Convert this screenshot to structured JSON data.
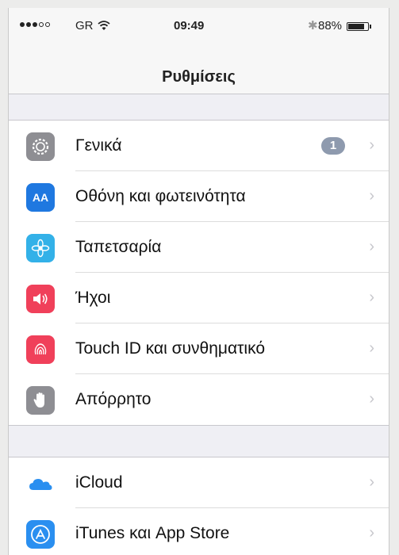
{
  "statusbar": {
    "carrier": "GR",
    "time": "09:49",
    "bluetooth": "✱",
    "battery_pct": "88%",
    "battery_level": 0.88,
    "signal_bars": 3,
    "signal_total": 5
  },
  "navbar": {
    "title": "Ρυθμίσεις"
  },
  "groups": [
    {
      "items": [
        {
          "label": "Γενικά",
          "icon": "gear-icon",
          "color": "#8e8e93",
          "badge": "1"
        },
        {
          "label": "Οθόνη και φωτεινότητα",
          "icon": "text-size-icon",
          "color": "#1f78e0",
          "icon_text": "AA"
        },
        {
          "label": "Ταπετσαρία",
          "icon": "flower-icon",
          "color": "#33b1e8"
        },
        {
          "label": "Ήχοι",
          "icon": "speaker-icon",
          "color": "#f0405a"
        },
        {
          "label": "Touch ID και συνθηματικό",
          "icon": "fingerprint-icon",
          "color": "#f0405a"
        },
        {
          "label": "Απόρρητο",
          "icon": "hand-icon",
          "color": "#8e8e93"
        }
      ]
    },
    {
      "items": [
        {
          "label": "iCloud",
          "icon": "cloud-icon",
          "color": "#ffffff"
        },
        {
          "label": "iTunes και App Store",
          "icon": "app-store-icon",
          "color": "#2a8ff0"
        }
      ]
    }
  ],
  "chevron": "›"
}
